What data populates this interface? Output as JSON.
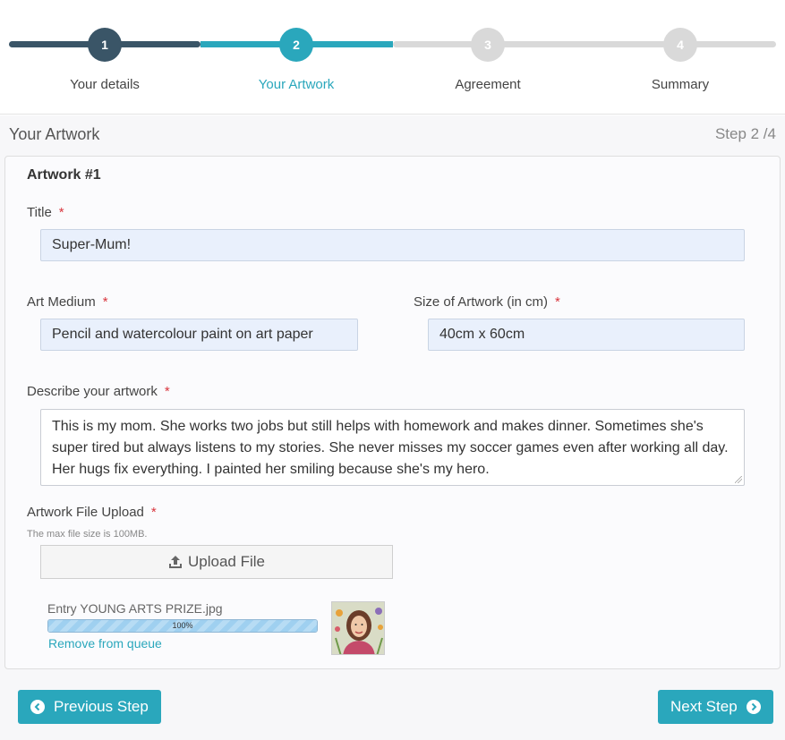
{
  "stepper": {
    "steps": [
      {
        "number": "1",
        "label": "Your details",
        "state": "completed"
      },
      {
        "number": "2",
        "label": "Your Artwork",
        "state": "active"
      },
      {
        "number": "3",
        "label": "Agreement",
        "state": "pending"
      },
      {
        "number": "4",
        "label": "Summary",
        "state": "pending"
      }
    ]
  },
  "section": {
    "title": "Your Artwork",
    "step_indicator": "Step 2 /4"
  },
  "artwork": {
    "heading": "Artwork #1",
    "required_mark": "*",
    "title_label": "Title",
    "title_value": "Super-Mum!",
    "medium_label": "Art Medium",
    "medium_value": "Pencil and watercolour paint on art paper",
    "size_label": "Size of Artwork (in cm)",
    "size_value": "40cm x 60cm",
    "description_label": "Describe your artwork",
    "description_value": "This is my mom. She works two jobs but still helps with homework and makes dinner. Sometimes she's super tired but always listens to my stories. She never misses my soccer games even after working all day. Her hugs fix everything. I painted her smiling because she's my hero.",
    "upload_label": "Artwork File Upload",
    "upload_hint": "The max file size is 100MB.",
    "upload_button": "Upload File",
    "upload_icon": "upload-icon",
    "file": {
      "name": "Entry YOUNG ARTS PRIZE.jpg",
      "progress_text": "100%",
      "progress": 1.0,
      "remove_label": "Remove from queue"
    }
  },
  "nav": {
    "previous_label": "Previous Step",
    "previous_icon": "chevron-left-circle-icon",
    "next_label": "Next Step",
    "next_icon": "chevron-right-circle-icon"
  },
  "colors": {
    "accent": "#2aa7bc",
    "completed": "#3a5567",
    "pending": "#d9d9d9",
    "required": "#d9363e"
  }
}
